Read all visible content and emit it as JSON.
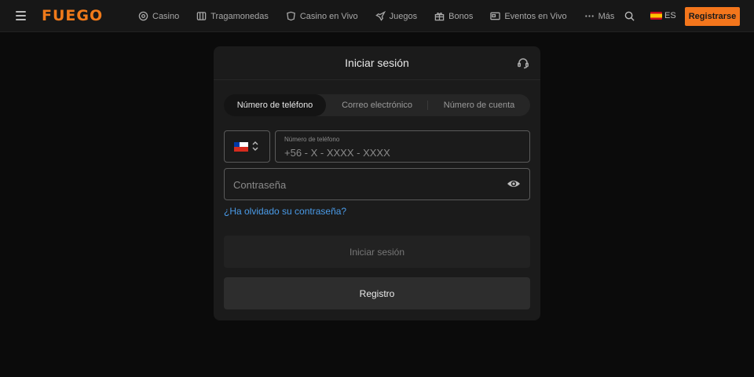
{
  "header": {
    "logo_text": "FUEGO",
    "nav": [
      {
        "label": "Casino",
        "icon": "casino-icon"
      },
      {
        "label": "Tragamonedas",
        "icon": "slots-icon"
      },
      {
        "label": "Casino en Vivo",
        "icon": "live-casino-icon"
      },
      {
        "label": "Juegos",
        "icon": "rocket-icon"
      },
      {
        "label": "Bonos",
        "icon": "gift-icon"
      },
      {
        "label": "Eventos en Vivo",
        "icon": "tv-icon"
      },
      {
        "label": "Más",
        "icon": "dots-icon"
      }
    ],
    "language": "ES",
    "register_label": "Registrarse"
  },
  "login": {
    "title": "Iniciar sesión",
    "tabs": [
      "Número de teléfono",
      "Correo electrónico",
      "Número de cuenta"
    ],
    "active_tab": 0,
    "phone_label": "Número de teléfono",
    "phone_placeholder": "+56 - X - XXXX - XXXX",
    "password_placeholder": "Contraseña",
    "forgot_label": "¿Ha olvidado su contraseña?",
    "login_button": "Iniciar sesión",
    "register_button": "Registro"
  },
  "colors": {
    "accent": "#f4761c",
    "link": "#4a9be8",
    "background": "#0b0b0b"
  }
}
